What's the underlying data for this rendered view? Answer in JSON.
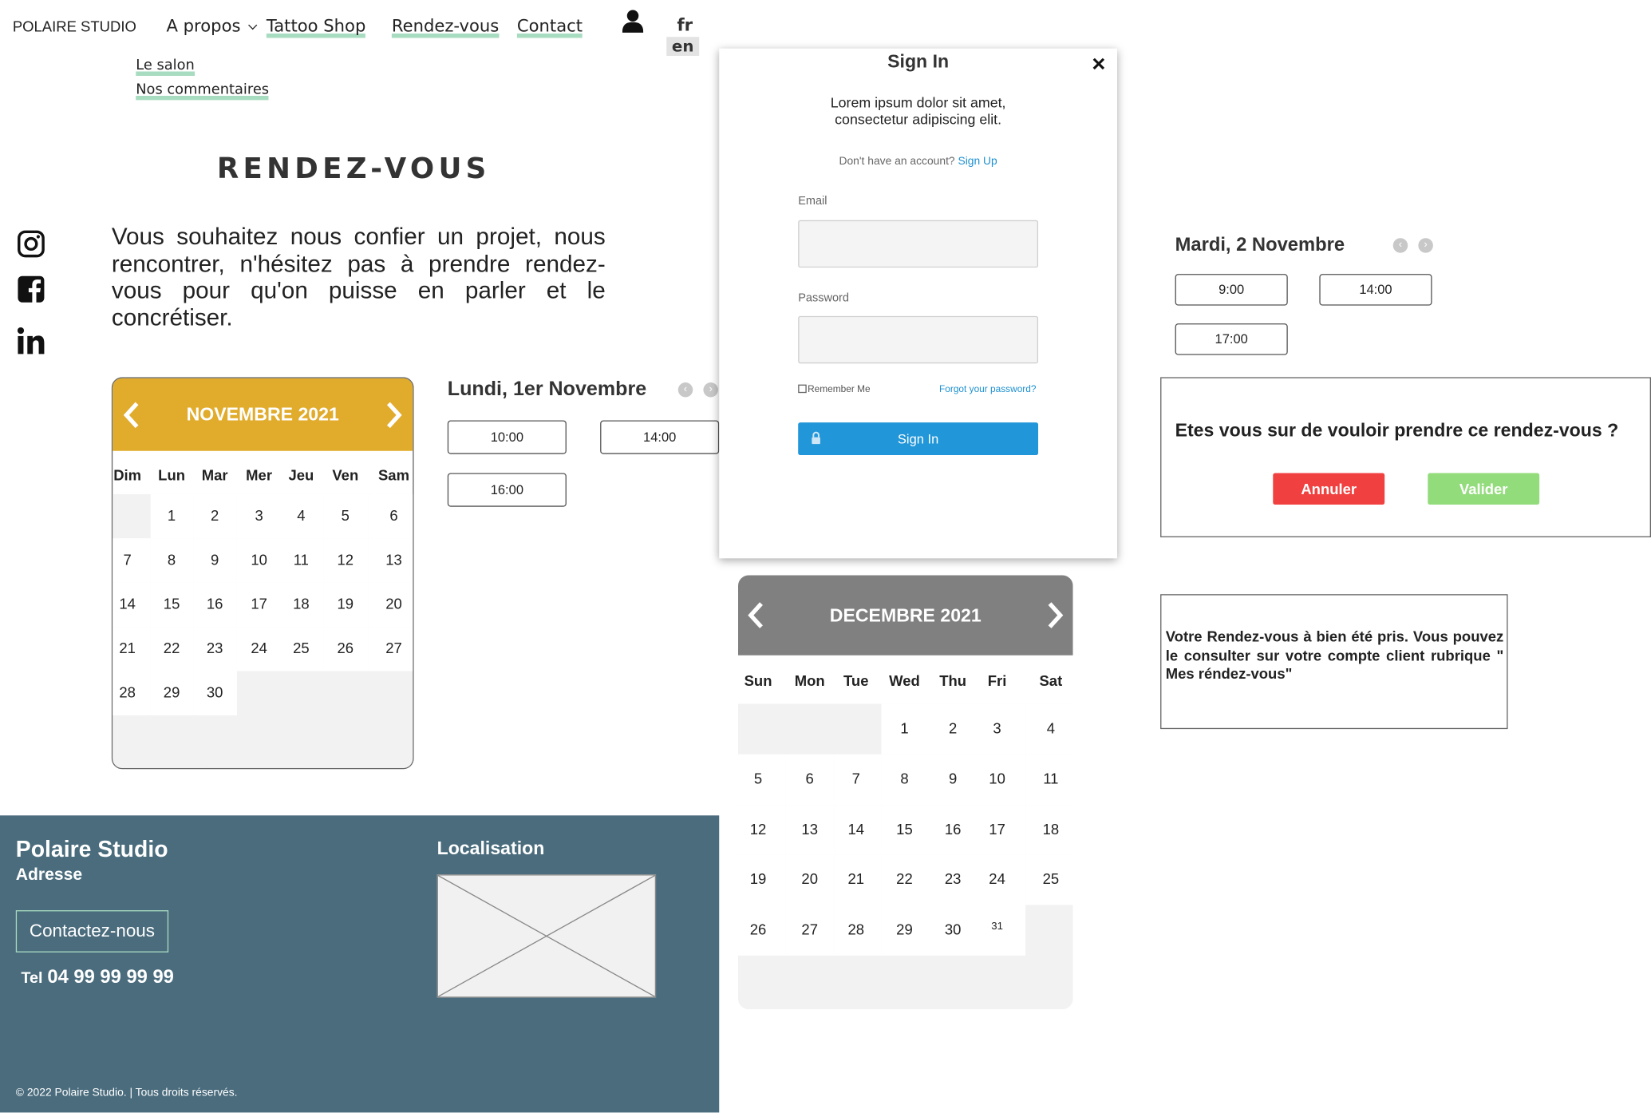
{
  "header": {
    "brand": "POLAIRE STUDIO",
    "nav": {
      "apropos": "A propos",
      "shop": "Tattoo Shop",
      "rdv": "Rendez-vous",
      "contact": "Contact"
    },
    "lang_fr": "fr",
    "lang_en": "en",
    "submenu": [
      "Le salon",
      "Nos commentaires"
    ]
  },
  "page": {
    "title": "RENDEZ-VOUS",
    "intro": "Vous souhaitez nous confier un projet, nous rencontrer, n'hésitez pas à prendre rendez-vous pour qu'on puisse en parler et le concrétiser."
  },
  "calendar_nov": {
    "title": "NOVEMBRE 2021",
    "header_color": "#e1ab2b",
    "weekdays": [
      "Dim",
      "Lun",
      "Mar",
      "Mer",
      "Jeu",
      "Ven",
      "Sam"
    ],
    "first_weekday_index": 1,
    "days_in_month": 30
  },
  "day_nov": {
    "title": "Lundi, 1er Novembre",
    "slots": [
      "10:00",
      "14:00",
      "16:00"
    ]
  },
  "signin": {
    "title": "Sign In",
    "close": "×",
    "text": "Lorem ipsum dolor sit amet, consectetur adipiscing elit.",
    "no_account": "Don't have an account?",
    "signup": "Sign Up",
    "email_label": "Email",
    "password_label": "Password",
    "remember": "Remember Me",
    "forgot": "Forgot your password?",
    "submit": "Sign In",
    "accent": "#2196d9"
  },
  "calendar_dec": {
    "title": "DECEMBRE 2021",
    "header_color": "#808080",
    "weekdays": [
      "Sun",
      "Mon",
      "Tue",
      "Wed",
      "Thu",
      "Fri",
      "Sat"
    ],
    "first_weekday_index": 3,
    "days_in_month": 31
  },
  "day_dec": {
    "title": "Mardi, 2 Novembre",
    "slots": [
      "9:00",
      "14:00",
      "17:00"
    ]
  },
  "confirm": {
    "question": "Etes vous sur de vouloir prendre ce rendez-vous ?",
    "cancel": "Annuler",
    "validate": "Valider",
    "cancel_color": "#f0403f",
    "validate_color": "#93dc7c"
  },
  "success": {
    "text": "Votre Rendez-vous à bien été pris. Vous pouvez le consulter sur votre compte client rubrique \" Mes réndez-vous\""
  },
  "footer": {
    "name": "Polaire Studio",
    "address": "Adresse",
    "contact_button": "Contactez-nous",
    "tel_label": "Tel",
    "tel": "04 99 99 99 99",
    "localisation": "Localisation",
    "copyright": "© 2022 Polaire Studio. | Tous droits réservés.",
    "bg_color": "#4a6c7d"
  }
}
